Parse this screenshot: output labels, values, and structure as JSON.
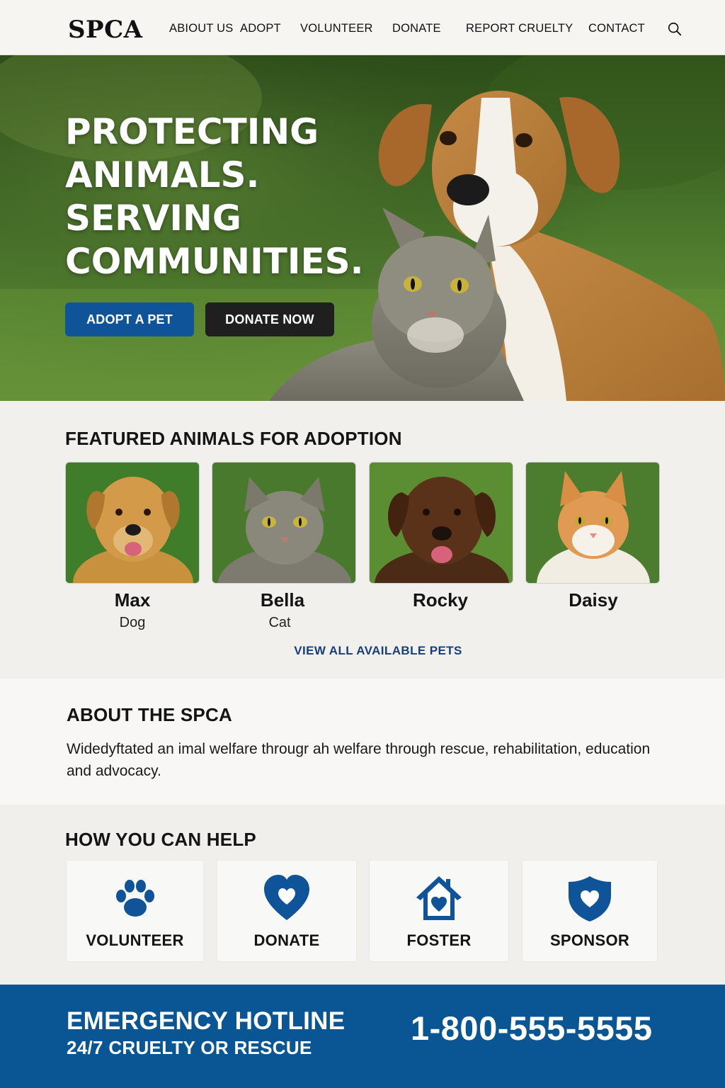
{
  "header": {
    "logo": "SPCA",
    "nav": [
      "ABIOUT US",
      "ADOPT",
      "VOLUNTEER",
      "DONATE",
      "REPORT CRUELTY",
      "CONTACT"
    ],
    "search_icon": "search-icon"
  },
  "hero": {
    "title_lines": [
      "PROTECTING",
      "ANIMALS.",
      "SERVING",
      "COMMUNITIES."
    ],
    "adopt_label": "ADOPT A PET",
    "donate_label": "DONATE NOW",
    "image": "dog-and-cat-photo"
  },
  "featured": {
    "title": "FEATURED ANIMALS FOR ADOPTION",
    "pets": [
      {
        "name": "Max",
        "type": "Dog",
        "photo": "golden-dog-photo"
      },
      {
        "name": "Bella",
        "type": "Cat",
        "photo": "tabby-cat-photo"
      },
      {
        "name": "Rocky",
        "type": "",
        "photo": "chocolate-dog-photo"
      },
      {
        "name": "Daisy",
        "type": "",
        "photo": "orange-cat-photo"
      }
    ],
    "view_all": "VIEW ALL AVAILABLE PETS"
  },
  "about": {
    "title": "ABOUT THE SPCA",
    "text": "Widedyftated an imal welfare througr ah welfare through rescue, rehabilitation, education and advocacy."
  },
  "help": {
    "title": "HOW YOU CAN HELP",
    "items": [
      {
        "label": "VOLUNTEER",
        "icon": "paw-icon"
      },
      {
        "label": "DONATE",
        "icon": "heart-icon"
      },
      {
        "label": "FOSTER",
        "icon": "house-heart-icon"
      },
      {
        "label": "SPONSOR",
        "icon": "shield-heart-icon"
      }
    ]
  },
  "hotline": {
    "title": "EMERGENCY HOTLINE",
    "subtitle": "24/7 CRUELTY OR RESCUE",
    "phone": "1-800-555-5555"
  },
  "colors": {
    "brand_blue": "#0a5594",
    "button_blue": "#0f5499",
    "button_dark": "#1f1f1f",
    "link_blue": "#173f78"
  }
}
